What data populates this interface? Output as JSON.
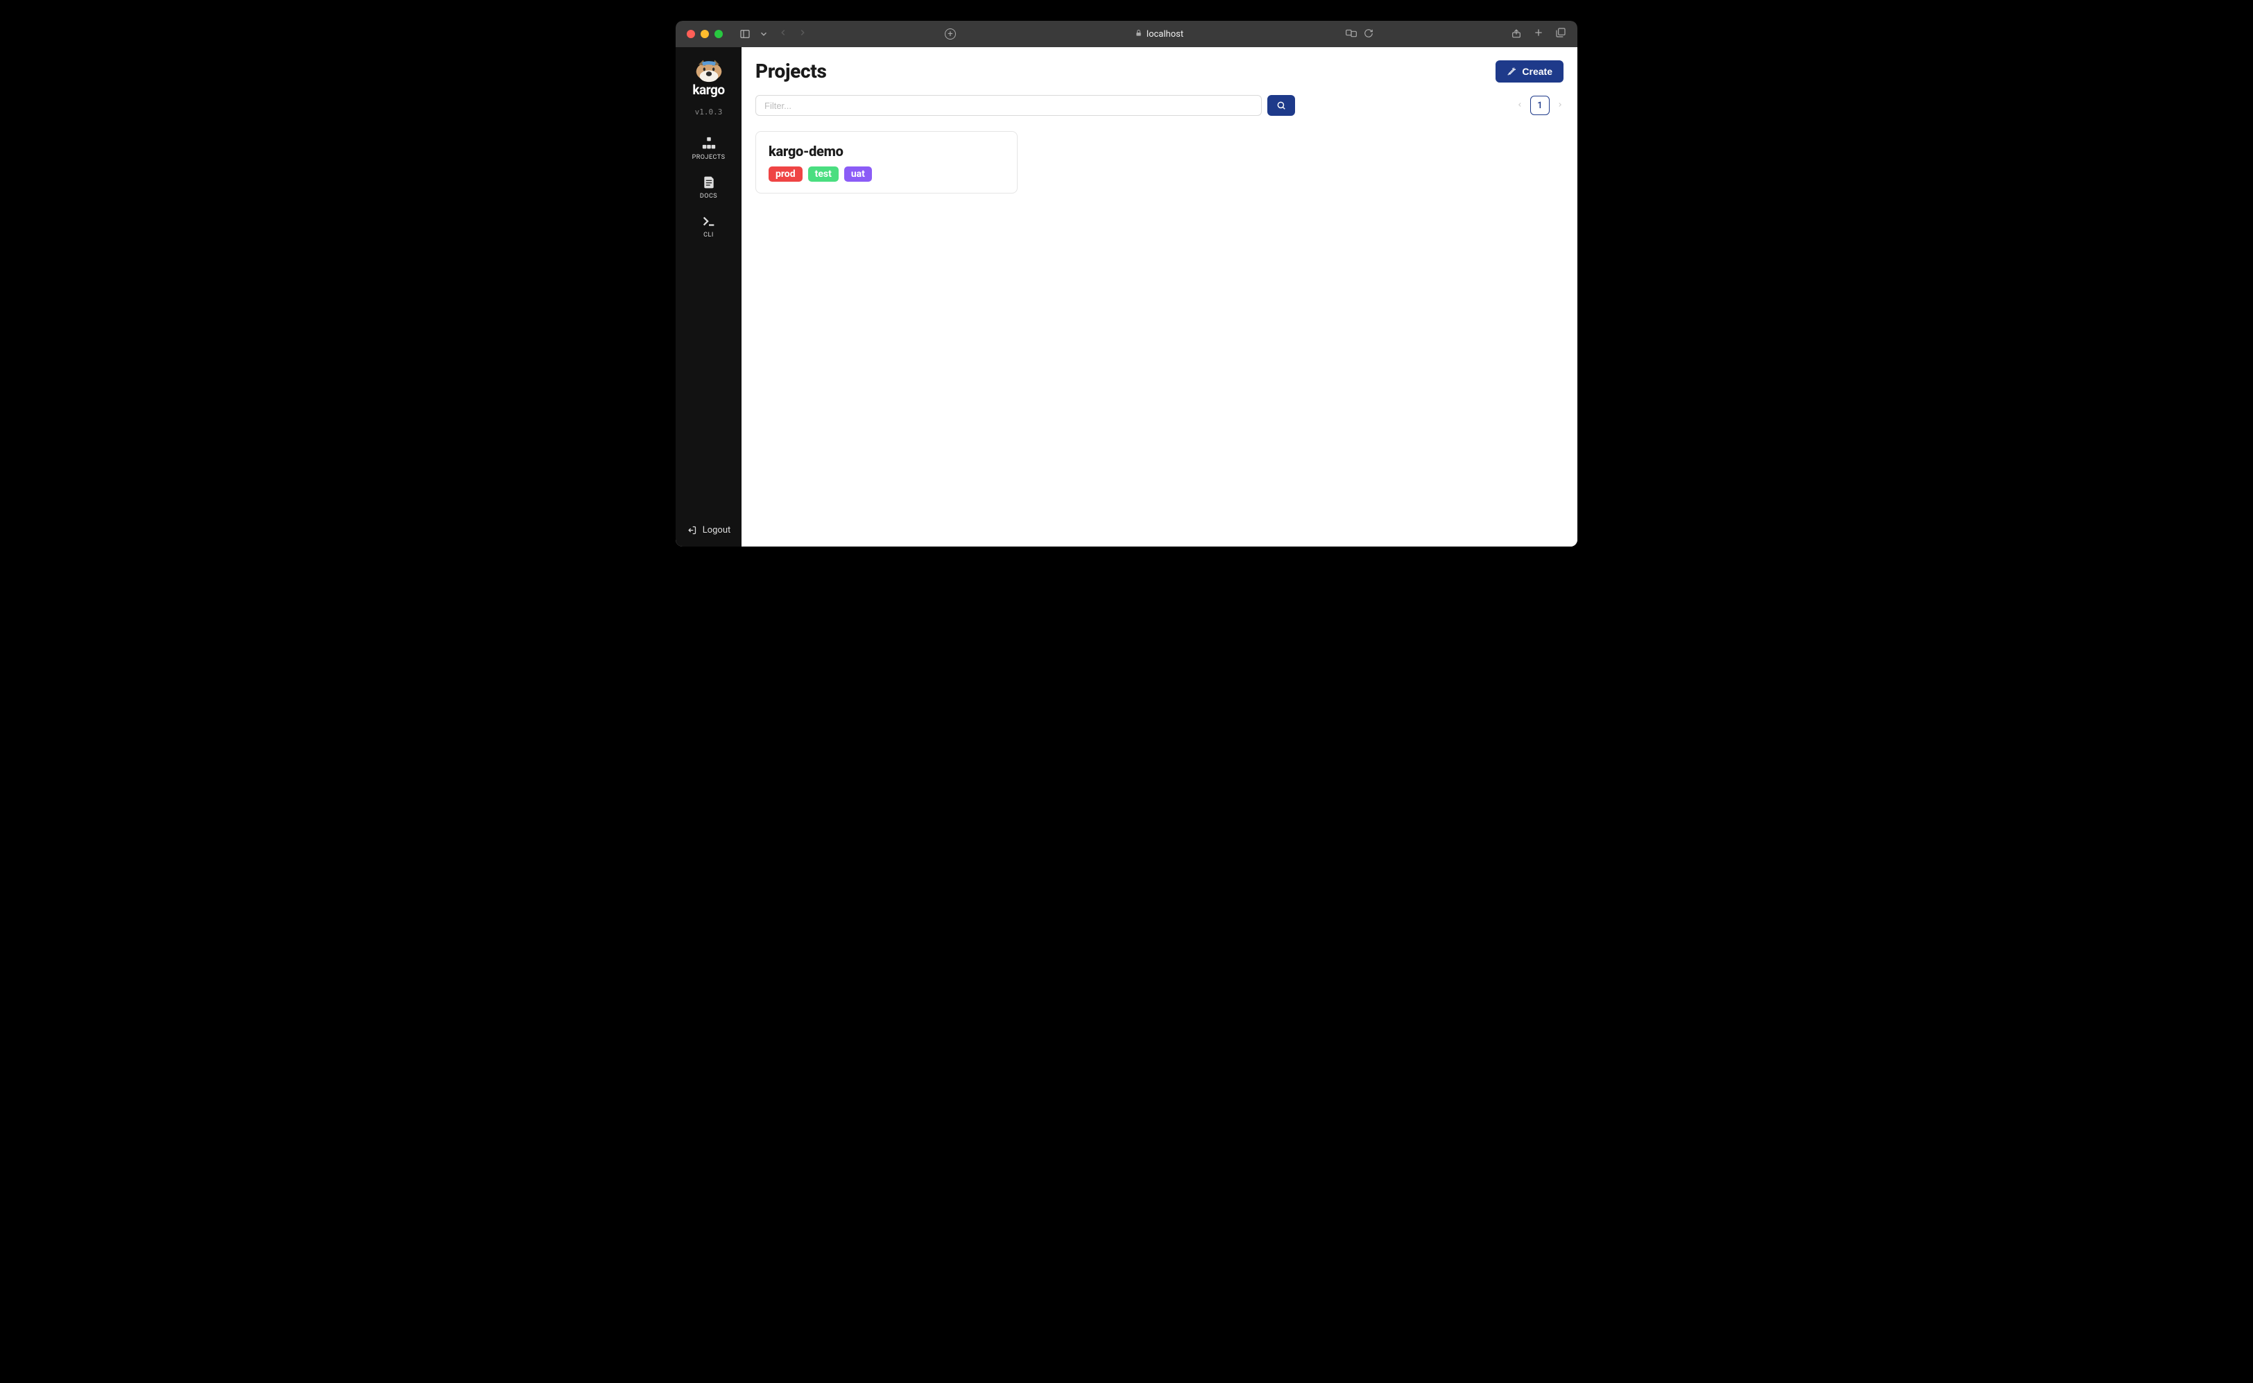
{
  "browser": {
    "address": "localhost"
  },
  "sidebar": {
    "brand": "kargo",
    "version": "v1.0.3",
    "items": [
      {
        "label": "PROJECTS"
      },
      {
        "label": "DOCS"
      },
      {
        "label": "CLI"
      }
    ],
    "logout_label": "Logout"
  },
  "page": {
    "title": "Projects",
    "create_label": "Create",
    "filter_placeholder": "Filter...",
    "pagination": {
      "current_page": "1"
    }
  },
  "projects": [
    {
      "name": "kargo-demo",
      "tags": [
        {
          "label": "prod",
          "variant": "prod"
        },
        {
          "label": "test",
          "variant": "test"
        },
        {
          "label": "uat",
          "variant": "uat"
        }
      ]
    }
  ]
}
